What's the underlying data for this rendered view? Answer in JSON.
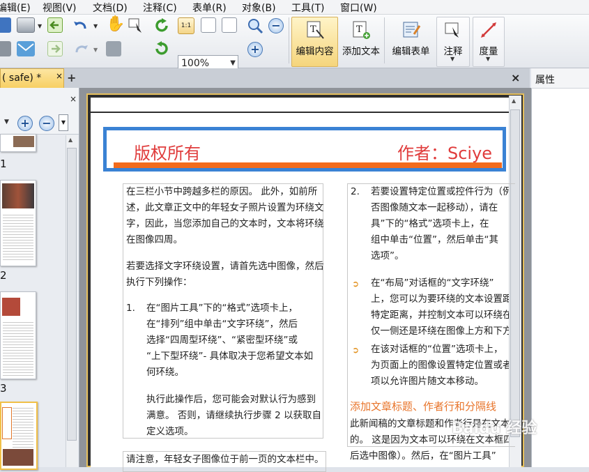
{
  "menu": {
    "items": [
      "编辑(E)",
      "视图(V)",
      "文档(D)",
      "注释(C)",
      "表单(R)",
      "对象(B)",
      "工具(T)",
      "窗口(W)"
    ]
  },
  "toolbar": {
    "zoom_value": "100%",
    "buttons": {
      "edit_content": "编辑内容",
      "add_text": "添加文本",
      "edit_form": "编辑表单",
      "annotate": "注释",
      "measure": "度量"
    }
  },
  "tabs": {
    "doc_tab_label": "( safe) *",
    "doc_tab_close": "×",
    "add_tab": "+",
    "close_doc": "×"
  },
  "properties_panel": {
    "title": "属性"
  },
  "thumbnail_panel": {
    "close": "×",
    "page_numbers": [
      "1",
      "2",
      "3"
    ]
  },
  "document": {
    "header_left": "版权所有",
    "header_right": "作者：Sciye",
    "left_column": {
      "p1": [
        "在三栏小节中跨越多栏的原因。 此外，如前所",
        "述，此文章正文中的年轻女子照片设置为环绕文",
        "字，因此，当您添加自己的文本时，文本将环绕",
        "在图像四周。"
      ],
      "p2": [
        "若要选择文字环绕设置，请首先选中图像，然后",
        "执行下列操作："
      ],
      "step1_num": "1.",
      "step1": [
        "在“图片工具”下的“格式”选项卡上，",
        "在“排列”组中单击“文字环绕”，然后",
        "选择“四周型环绕”、“紧密型环绕”或",
        "“上下型环绕”- 具体取决于您希望文本如",
        "何环绕。"
      ],
      "step1b": [
        "执行此操作后，您可能会对默认行为感到",
        "满意。 否则，请继续执行步骤 2 以获取自",
        "定义选项。"
      ],
      "bottom": "请注意，年轻女子图像位于前一页的文本栏中。"
    },
    "right_column": {
      "step2_num": "2.",
      "step2": [
        "若要设置特定位置或控件行为（例",
        "否图像随文本一起移动），请在",
        "具”下的“格式”选项卡上，在",
        "组中单击“位置”，然后单击“其",
        "选项”。"
      ],
      "bullet1": [
        "在“布局”对话框的“文字环绕”",
        "上，您可以为要环绕的文本设置距",
        "特定距离，并控制文本可以环绕在",
        "仅一侧还是环绕在图像上方和下方"
      ],
      "bullet2": [
        "在该对话框的“位置”选项卡上，",
        "为页面上的图像设置特定位置或者",
        "项以允许图片随文本移动。"
      ],
      "section_title": "添加文章标题、作者行和分隔线",
      "section_text": [
        "此新闻稿的文章标题和作者行是在文本",
        "的。 这是因为文本可以环绕在文本框四",
        "后选中图像）。然后，在“图片工具”"
      ]
    },
    "watermark": "Baidu 经验"
  },
  "colors": {
    "header_red": "#e03c3c",
    "header_border_blue": "#3a82d4",
    "header_line_orange": "#f26b1d",
    "active_tab_yellow": "#f7cf63",
    "section_orange": "#e8742a"
  }
}
